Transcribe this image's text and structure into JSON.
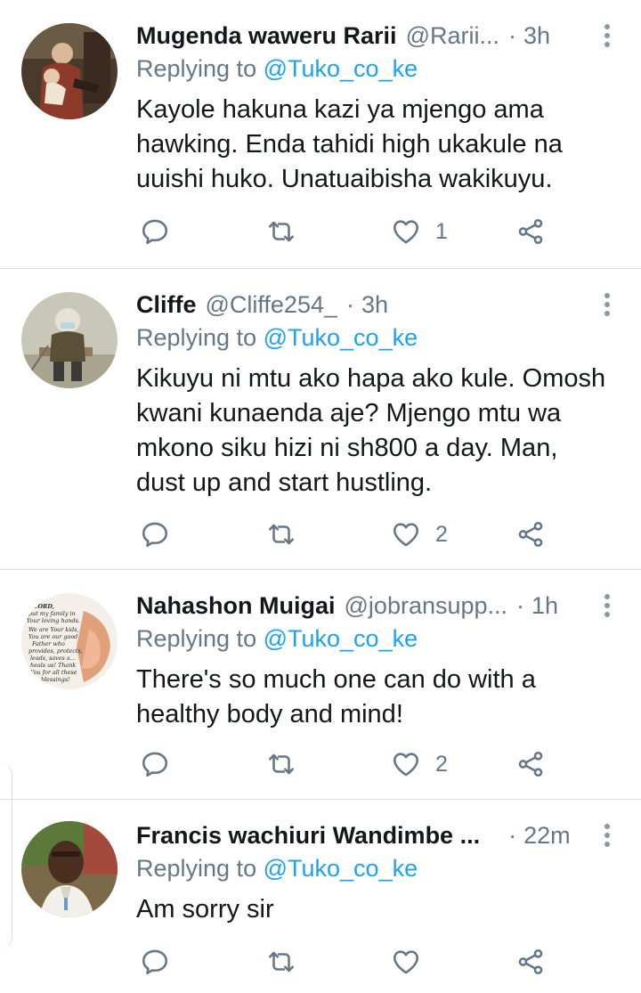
{
  "colors": {
    "name": "#14171a",
    "secondary": "#657786",
    "mention": "#1da1f2",
    "divider": "#d8dde1",
    "icon": "#657786"
  },
  "icons": {
    "reply": "reply-icon",
    "retweet": "retweet-icon",
    "like": "heart-icon",
    "share": "share-icon",
    "more": "more-vertical-icon"
  },
  "tweets": [
    {
      "name": "Mugenda waweru Rarii",
      "handle": "@Rarii...",
      "dot": "·",
      "time": "3h",
      "replying_prefix": "Replying to",
      "replying_to": "@Tuko_co_ke",
      "lines": [
        "Kayole hakuna kazi ya mjengo ama",
        "hawking. Enda tahidi high ukakule na",
        "uuishi huko. Unatuaibisha wakikuyu."
      ],
      "likes": "1"
    },
    {
      "name": "Cliffe",
      "handle": "@Cliffe254_",
      "dot": "·",
      "time": "3h",
      "replying_prefix": "Replying to",
      "replying_to": "@Tuko_co_ke",
      "lines": [
        "Kikuyu ni mtu ako hapa ako kule. Omosh",
        "kwani kunaenda aje? Mjengo mtu wa",
        "mkono siku hizi ni sh800 a day. Man,",
        "dust up and start hustling."
      ],
      "likes": "2"
    },
    {
      "name": "Nahashon Muigai",
      "handle": "@jobransupp...",
      "dot": "·",
      "time": "1h",
      "replying_prefix": "Replying to",
      "replying_to": "@Tuko_co_ke",
      "lines": [
        "There's so much one can do with a",
        "healthy body and mind!"
      ],
      "likes": "2",
      "avatar_text": [
        "LORD,",
        "put my family in",
        "Your loving hands.",
        "We are Your kids,",
        "You are our good",
        "Father who",
        "provides, protects,",
        "leads, saves a...",
        "heals us! Thank",
        "You for all these",
        "blessings!"
      ]
    },
    {
      "name": "Francis wachiuri Wandimbe ...",
      "handle": "",
      "dot": "·",
      "time": "22m",
      "replying_prefix": "Replying to",
      "replying_to": "@Tuko_co_ke",
      "lines": [
        "Am sorry sir"
      ],
      "likes": ""
    }
  ]
}
